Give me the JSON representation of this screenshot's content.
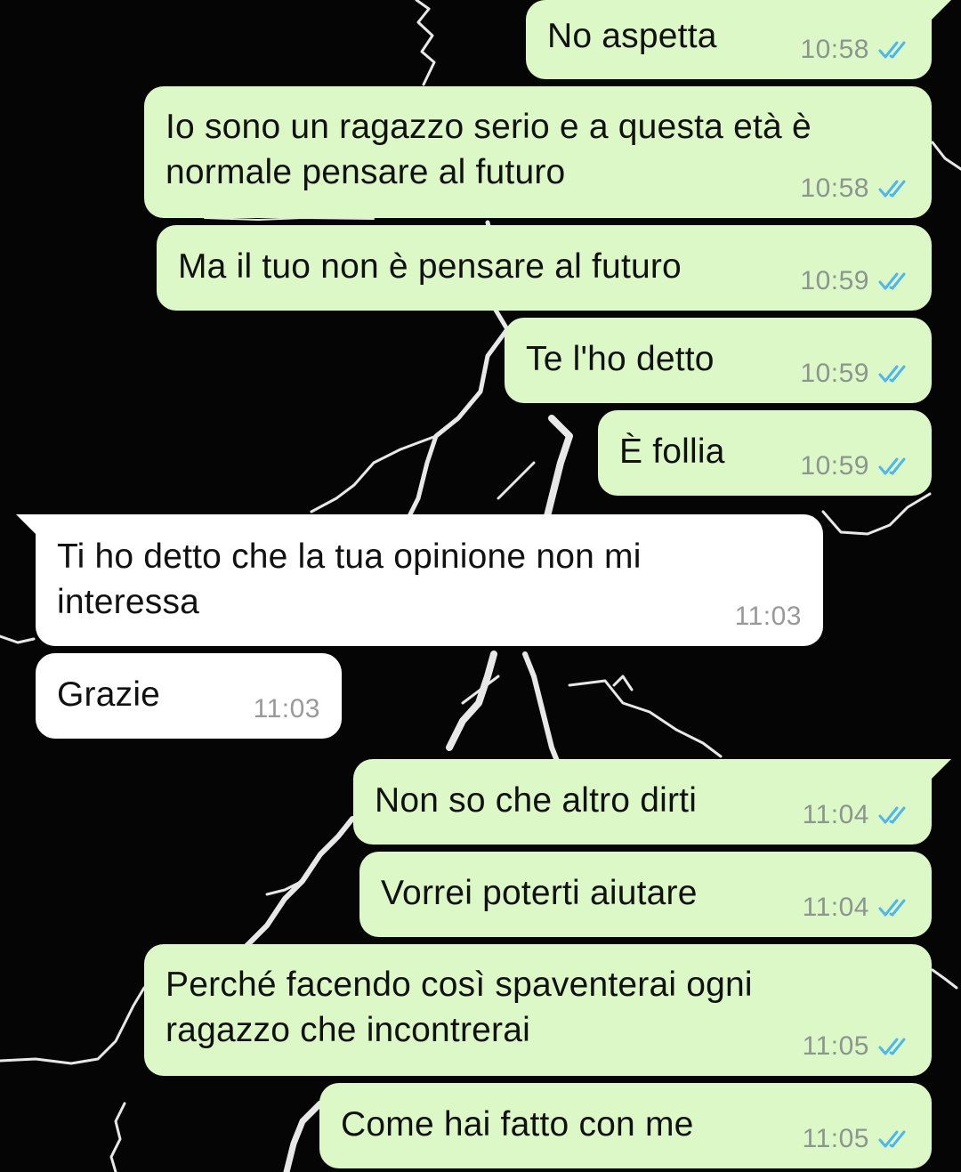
{
  "conversation": {
    "messages": [
      {
        "direction": "out",
        "text": "No aspetta",
        "time": "10:58",
        "status_icon": "double-check-read-icon"
      },
      {
        "direction": "out",
        "text": "Io sono un ragazzo serio e a questa età è\nnormale pensare al futuro",
        "time": "10:58",
        "status_icon": "double-check-read-icon"
      },
      {
        "direction": "out",
        "text": "Ma il tuo non è pensare al futuro",
        "time": "10:59",
        "status_icon": "double-check-read-icon"
      },
      {
        "direction": "out",
        "text": "Te l'ho detto",
        "time": "10:59",
        "status_icon": "double-check-read-icon"
      },
      {
        "direction": "out",
        "text": "È follia",
        "time": "10:59",
        "status_icon": "double-check-read-icon"
      },
      {
        "direction": "in",
        "text": "Ti ho detto che la tua opinione non mi\ninteressa",
        "time": "11:03"
      },
      {
        "direction": "in",
        "text": "Grazie",
        "time": "11:03"
      },
      {
        "direction": "out",
        "text": "Non so che altro dirti",
        "time": "11:04",
        "status_icon": "double-check-read-icon"
      },
      {
        "direction": "out",
        "text": "Vorrei poterti aiutare",
        "time": "11:04",
        "status_icon": "double-check-read-icon"
      },
      {
        "direction": "out",
        "text": "Perché facendo così spaventerai ogni\nragazzo che incontrerai",
        "time": "11:05",
        "status_icon": "double-check-read-icon"
      },
      {
        "direction": "out",
        "text": "Come hai fatto con me",
        "time": "11:05",
        "status_icon": "double-check-read-icon"
      }
    ]
  },
  "colors": {
    "outgoing_bubble": "#dcf8c6",
    "incoming_bubble": "#ffffff",
    "read_ticks": "#4fb6ec",
    "wallpaper": "#050505"
  },
  "wallpaper": {
    "icon": "lightning-wallpaper-icon"
  }
}
